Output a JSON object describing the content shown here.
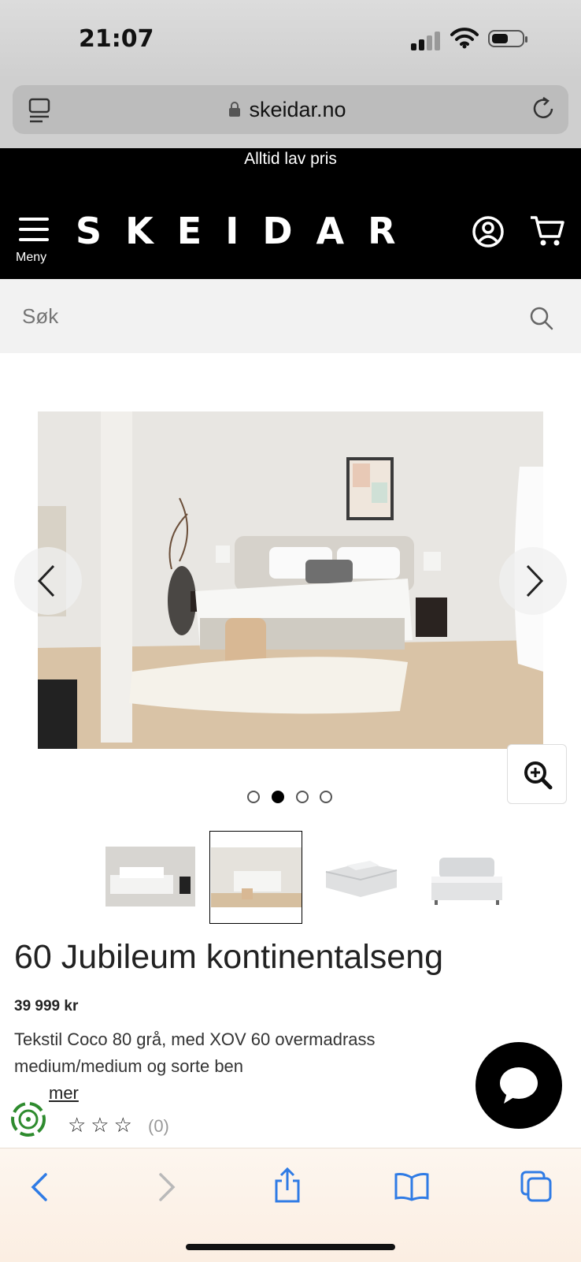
{
  "status_bar": {
    "time": "21:07"
  },
  "browser": {
    "url": "skeidar.no"
  },
  "header": {
    "promo": "Alltid lav pris",
    "menu_label": "Meny",
    "logo": "SKEIDAR"
  },
  "search": {
    "placeholder": "Søk"
  },
  "gallery": {
    "dots": 4,
    "active_dot": 2,
    "thumbnails": 4,
    "selected_thumbnail": 2
  },
  "product": {
    "title": "60 Jubileum kontinentalseng",
    "price": "39 999 kr",
    "description": "Tekstil Coco 80 grå, med XOV 60 overmadrass medium/medium og sorte ben",
    "read_more": "mer",
    "stars": "☆☆☆",
    "rating_count": "(0)"
  },
  "colors": {
    "header_bg": "#000000",
    "search_bg": "#f2f2f2",
    "toolbar_blue": "#2f7be5",
    "eco_green": "#2e8b2e"
  }
}
